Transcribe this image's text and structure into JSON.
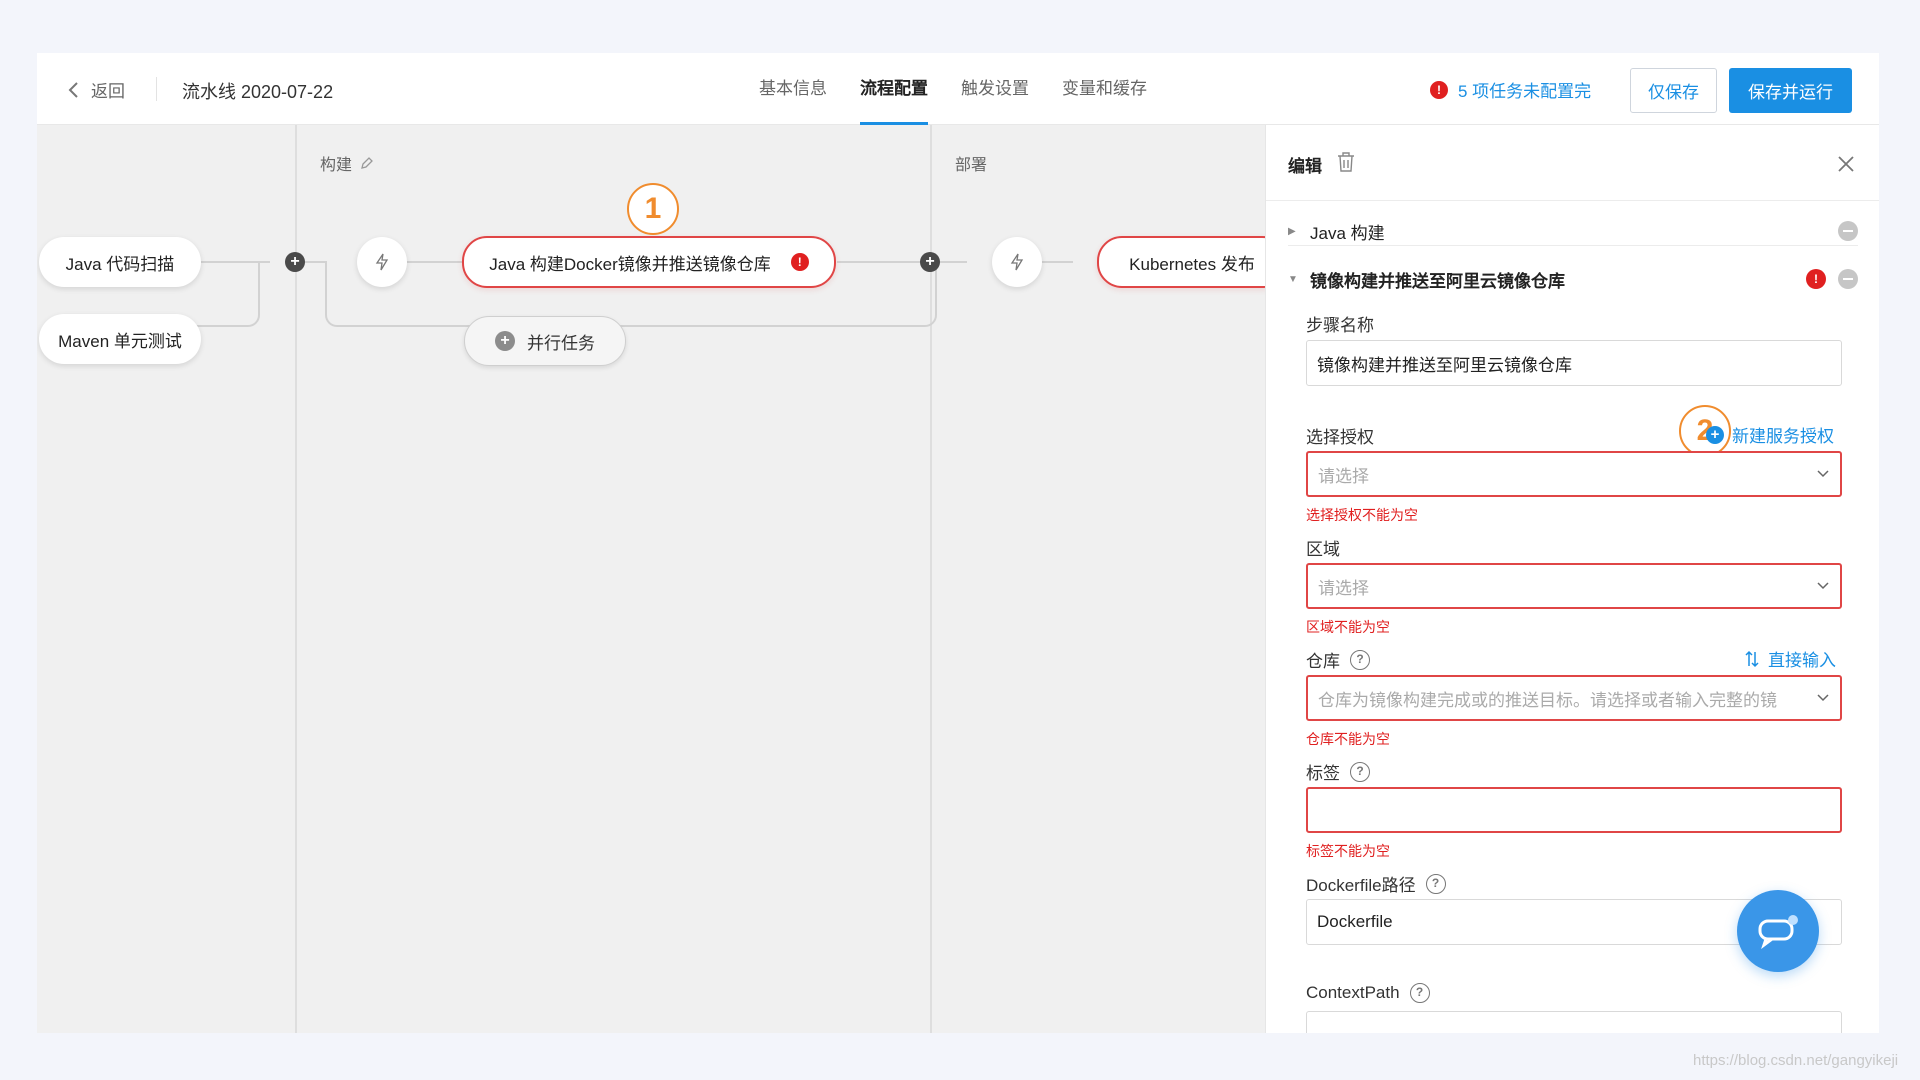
{
  "header": {
    "back_label": "返回",
    "pipeline_name": "流水线 2020-07-22",
    "tabs": [
      {
        "label": "基本信息"
      },
      {
        "label": "流程配置"
      },
      {
        "label": "触发设置"
      },
      {
        "label": "变量和缓存"
      }
    ],
    "warning_text": "5 项任务未配置完",
    "save_only_label": "仅保存",
    "save_run_label": "保存并运行"
  },
  "canvas": {
    "stages": [
      {
        "label": "构建"
      },
      {
        "label": "部署"
      }
    ],
    "nodes": {
      "java_scan": "Java 代码扫描",
      "maven_test": "Maven 单元测试",
      "java_docker_build": "Java 构建Docker镜像并推送镜像仓库",
      "parallel_task": "并行任务",
      "k8s_deploy": "Kubernetes 发布"
    },
    "markers": {
      "m1": "1",
      "m2": "2"
    }
  },
  "panel": {
    "title": "编辑",
    "sections": {
      "java_build": "Java 构建",
      "image_build": "镜像构建并推送至阿里云镜像仓库"
    },
    "fields": {
      "step_name": {
        "label": "步骤名称",
        "value": "镜像构建并推送至阿里云镜像仓库"
      },
      "auth": {
        "label": "选择授权",
        "placeholder": "请选择",
        "error": "选择授权不能为空",
        "link": "新建服务授权"
      },
      "region": {
        "label": "区域",
        "placeholder": "请选择",
        "error": "区域不能为空"
      },
      "repo": {
        "label": "仓库",
        "placeholder": "仓库为镜像构建完成或的推送目标。请选择或者输入完整的镜",
        "error": "仓库不能为空",
        "link": "直接输入"
      },
      "tag": {
        "label": "标签",
        "error": "标签不能为空"
      },
      "dockerfile": {
        "label": "Dockerfile路径",
        "value": "Dockerfile"
      },
      "context_path": {
        "label": "ContextPath"
      }
    }
  },
  "watermark": "https://blog.csdn.net/gangyikeji",
  "colors": {
    "accent": "#1a8fe3",
    "error": "#e02020",
    "marker": "#f08c2e"
  }
}
